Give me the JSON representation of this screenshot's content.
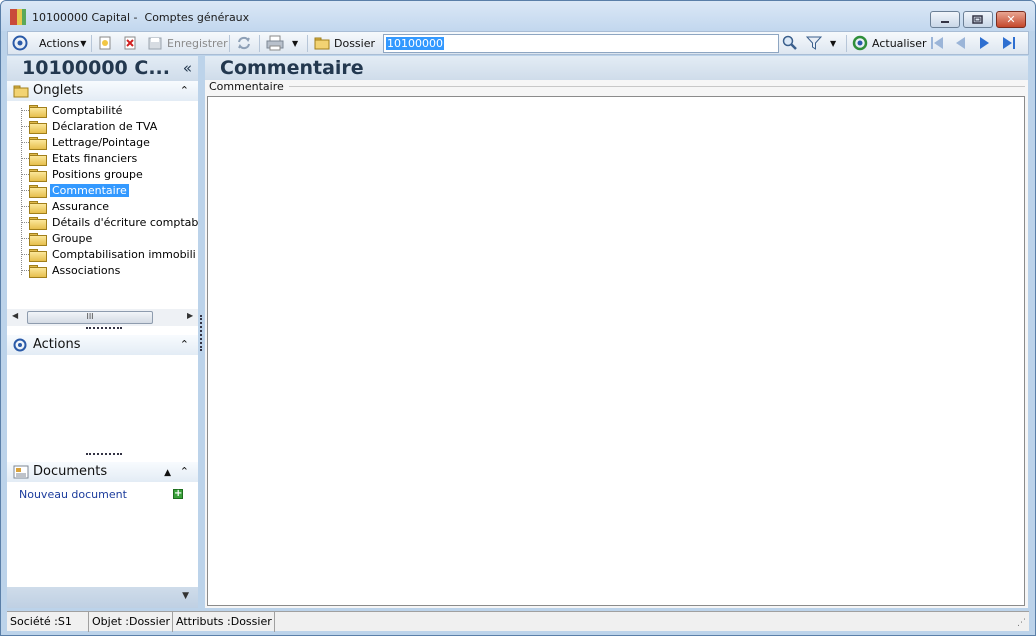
{
  "window": {
    "title": "10100000 Capital -  Comptes généraux",
    "buttons": [
      "minimize",
      "restore",
      "close"
    ]
  },
  "toolbar": {
    "actions_label": "Actions",
    "save_label": "Enregistrer",
    "dossier_label": "Dossier",
    "search_value": "10100000",
    "refresh_label": "Actualiser"
  },
  "left_panel": {
    "title": "10100000 C...",
    "collapse_glyph": "«",
    "tabs_section": "Onglets",
    "tree": [
      {
        "label": "Comptabilité",
        "selected": false
      },
      {
        "label": "Déclaration de TVA",
        "selected": false
      },
      {
        "label": "Lettrage/Pointage",
        "selected": false
      },
      {
        "label": "Etats financiers",
        "selected": false
      },
      {
        "label": "Positions groupe",
        "selected": false
      },
      {
        "label": "Commentaire",
        "selected": true
      },
      {
        "label": "Assurance",
        "selected": false
      },
      {
        "label": "Détails d'écriture comptab",
        "selected": false
      },
      {
        "label": "Groupe",
        "selected": false
      },
      {
        "label": "Comptabilisation immobili",
        "selected": false
      },
      {
        "label": "Associations",
        "selected": false
      }
    ],
    "scroll_thumb": "III",
    "actions_section": "Actions",
    "documents_section": "Documents",
    "new_document_link": "Nouveau document"
  },
  "main": {
    "title": "Commentaire",
    "group_label": "Commentaire",
    "text_value": ""
  },
  "statusbar": {
    "company": "Société :S1",
    "object": "Objet :Dossier",
    "attributes": "Attributs :Dossier"
  },
  "colors": {
    "window_bg": "#bcd3ea",
    "header_text": "#23384f",
    "selection": "#3399ff",
    "link": "#1c3c9c"
  }
}
